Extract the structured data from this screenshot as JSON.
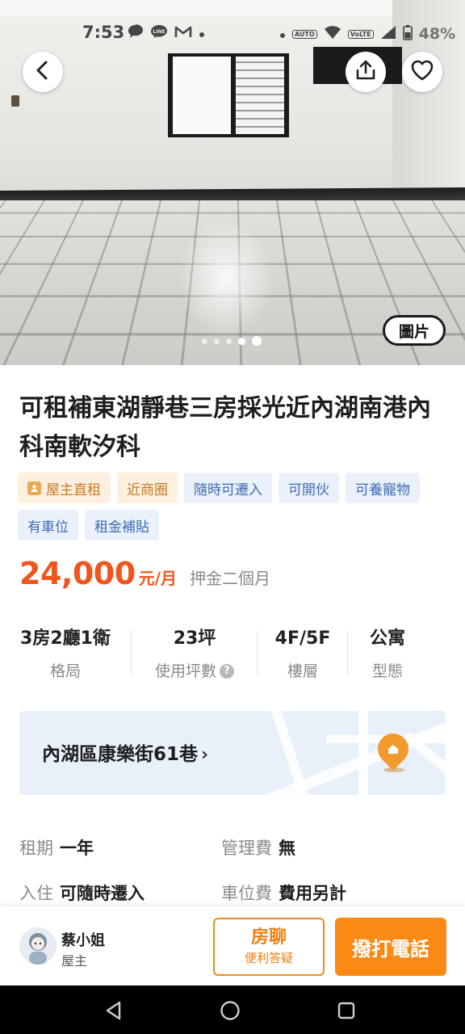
{
  "status_bar": {
    "time": "7:53",
    "battery": "48%"
  },
  "gallery": {
    "photo_button": "圖片",
    "dot_count": 5
  },
  "listing": {
    "title": "可租補東湖靜巷三房採光近內湖南港內科南軟汐科",
    "tags": [
      {
        "label": "屋主直租",
        "style": "owner"
      },
      {
        "label": "近商圈",
        "style": "warm"
      },
      {
        "label": "隨時可遷入",
        "style": "blue"
      },
      {
        "label": "可開伙",
        "style": "blue"
      },
      {
        "label": "可養寵物",
        "style": "blue"
      },
      {
        "label": "有車位",
        "style": "blue"
      },
      {
        "label": "租金補貼",
        "style": "blue"
      }
    ],
    "price": "24,000",
    "price_unit": "元/月",
    "deposit": "押金二個月",
    "specs": [
      {
        "value": "3房2廳1衛",
        "label": "格局"
      },
      {
        "value": "23坪",
        "label": "使用坪數"
      },
      {
        "value": "4F/5F",
        "label": "樓層"
      },
      {
        "value": "公寓",
        "label": "型態"
      }
    ],
    "address": "內湖區康樂街61巷",
    "details": [
      {
        "key": "租期",
        "value": "一年"
      },
      {
        "key": "管理費",
        "value": "無"
      },
      {
        "key": "入住",
        "value": "可隨時遷入"
      },
      {
        "key": "車位費",
        "value": "費用另計"
      }
    ]
  },
  "contact": {
    "name": "蔡小姐",
    "role": "屋主",
    "chat_label": "房聊",
    "chat_sub": "便利答疑",
    "call_label": "撥打電話"
  },
  "colors": {
    "price": "#f0551e",
    "accent": "#fb8a14",
    "tag_blue_text": "#3f6db1",
    "tag_warm_text": "#c97a24"
  }
}
